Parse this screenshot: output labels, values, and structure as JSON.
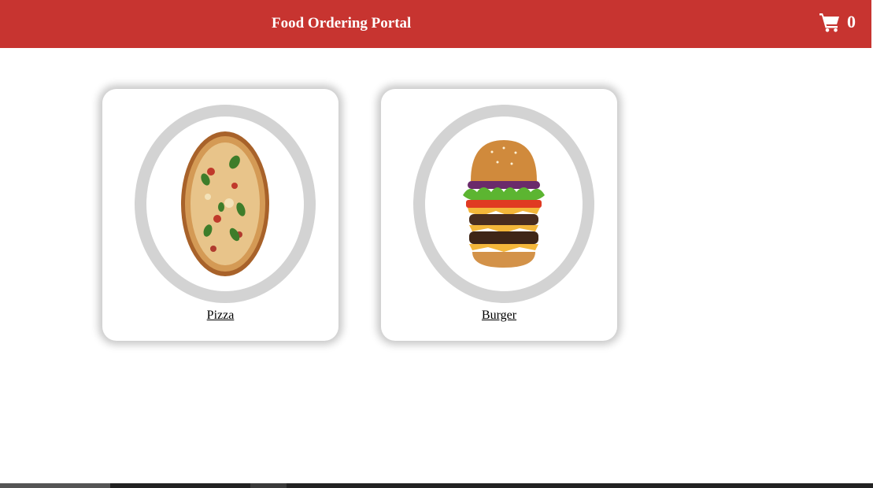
{
  "header": {
    "title": "Food Ordering Portal",
    "background_color": "#c73430",
    "cart": {
      "icon": "shopping-cart-icon",
      "count": "0"
    }
  },
  "menu": {
    "items": [
      {
        "label": "Pizza",
        "image": "pizza-image"
      },
      {
        "label": "Burger",
        "image": "burger-image"
      }
    ]
  },
  "colors": {
    "accent": "#c73430",
    "ring": "#d3d3d3"
  }
}
